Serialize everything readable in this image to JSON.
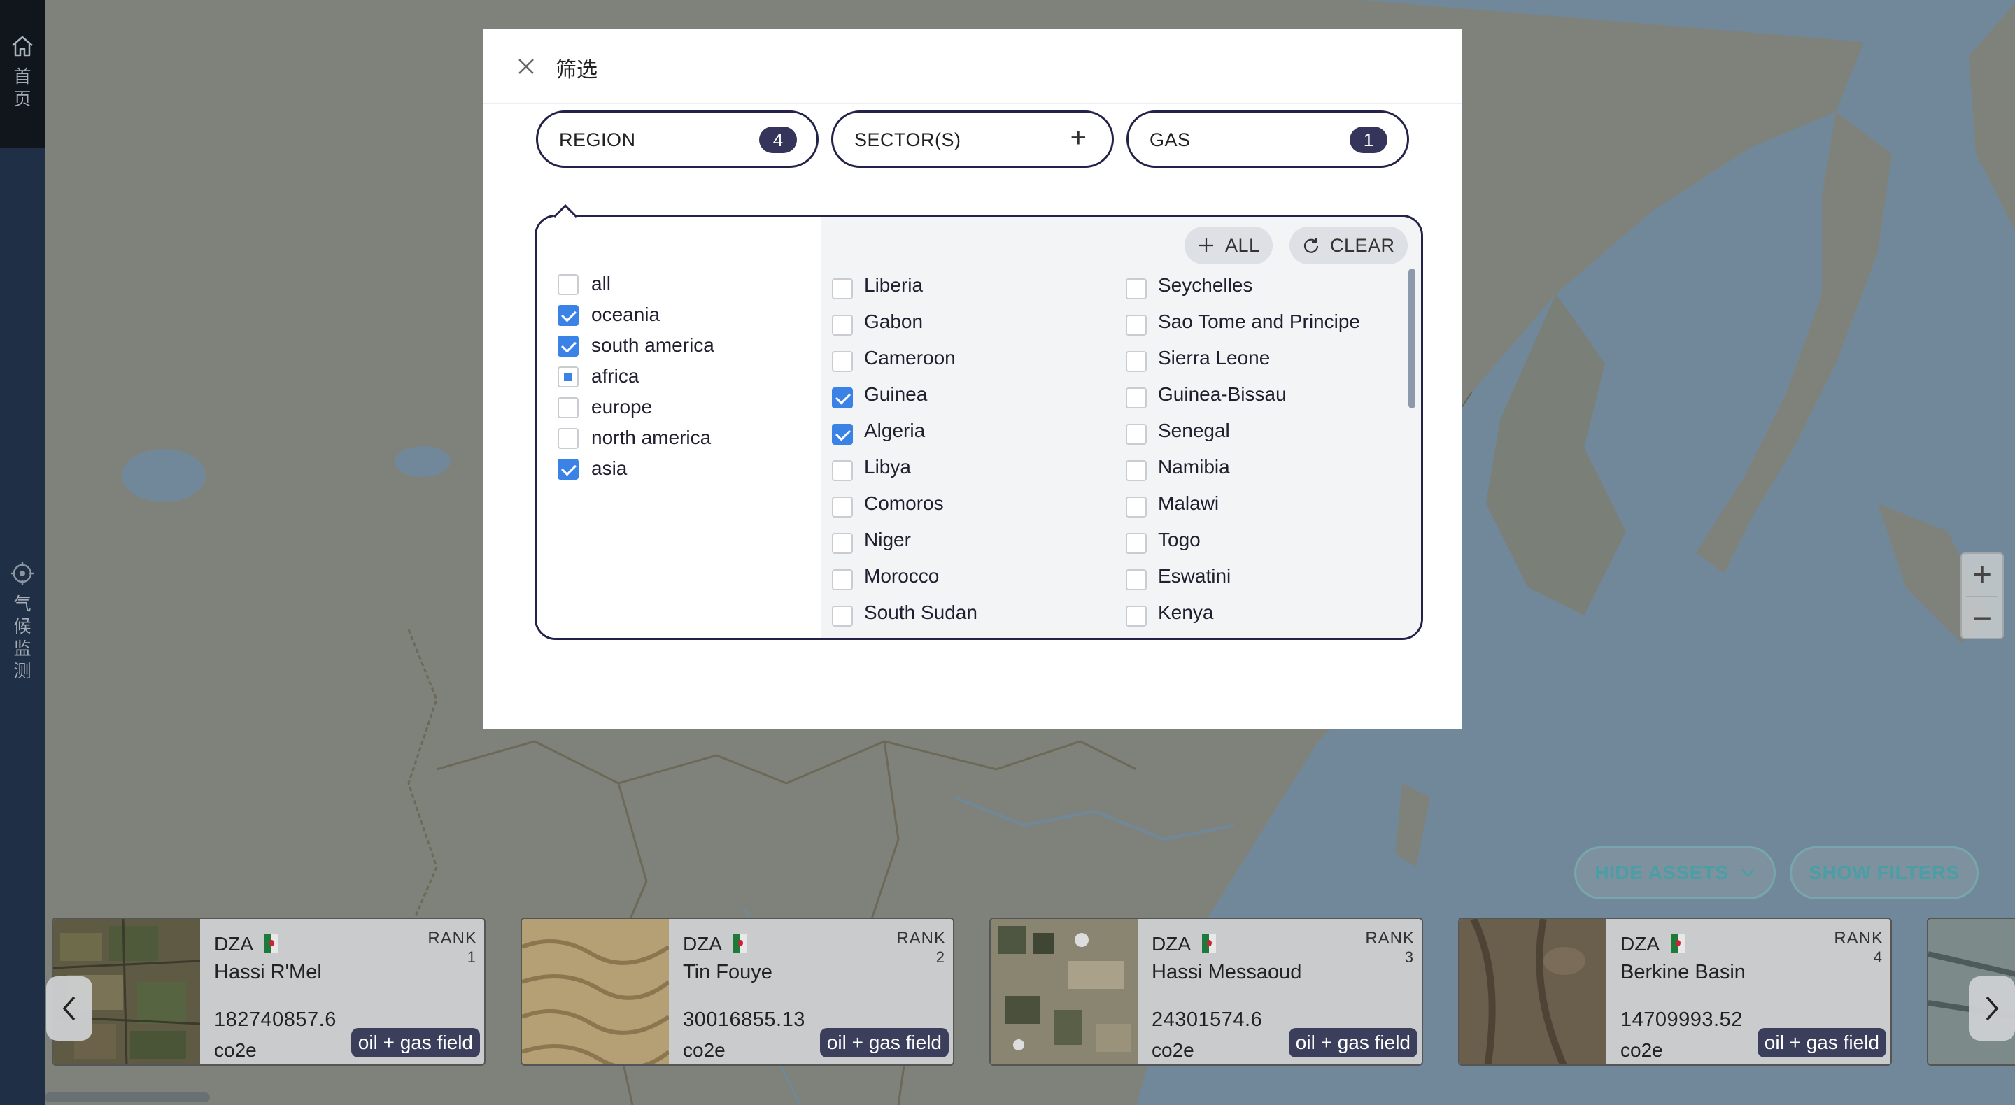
{
  "nav": {
    "home_label": "首页",
    "climate_label": "气候监测"
  },
  "modal": {
    "title": "筛选",
    "filters": [
      {
        "label": "REGION",
        "badge": "4"
      },
      {
        "label": "SECTOR(S)",
        "badge": "+"
      },
      {
        "label": "GAS",
        "badge": "1"
      }
    ],
    "chips": {
      "all_label": "ALL",
      "clear_label": "CLEAR"
    },
    "regions": [
      {
        "label": "all",
        "state": "unchecked"
      },
      {
        "label": "oceania",
        "state": "checked"
      },
      {
        "label": "south america",
        "state": "checked"
      },
      {
        "label": "africa",
        "state": "partial"
      },
      {
        "label": "europe",
        "state": "unchecked"
      },
      {
        "label": "north america",
        "state": "unchecked"
      },
      {
        "label": "asia",
        "state": "checked"
      }
    ],
    "countries_col1": [
      {
        "label": "Liberia",
        "checked": false
      },
      {
        "label": "Gabon",
        "checked": false
      },
      {
        "label": "Cameroon",
        "checked": false
      },
      {
        "label": "Guinea",
        "checked": true
      },
      {
        "label": "Algeria",
        "checked": true
      },
      {
        "label": "Libya",
        "checked": false
      },
      {
        "label": "Comoros",
        "checked": false
      },
      {
        "label": "Niger",
        "checked": false
      },
      {
        "label": "Morocco",
        "checked": false
      },
      {
        "label": "South Sudan",
        "checked": false
      }
    ],
    "countries_col2": [
      {
        "label": "Seychelles",
        "checked": false
      },
      {
        "label": "Sao Tome and Principe",
        "checked": false
      },
      {
        "label": "Sierra Leone",
        "checked": false
      },
      {
        "label": "Guinea-Bissau",
        "checked": false
      },
      {
        "label": "Senegal",
        "checked": false
      },
      {
        "label": "Namibia",
        "checked": false
      },
      {
        "label": "Malawi",
        "checked": false
      },
      {
        "label": "Togo",
        "checked": false
      },
      {
        "label": "Eswatini",
        "checked": false
      },
      {
        "label": "Kenya",
        "checked": false
      }
    ]
  },
  "controls": {
    "hide_assets_label": "HIDE ASSETS",
    "show_filters_label": "SHOW FILTERS",
    "zoom_in": "+",
    "zoom_out": "−"
  },
  "assets": [
    {
      "iso": "DZA",
      "rank_label": "RANK",
      "rank": "1",
      "name": "Hassi R'Mel",
      "value": "182740857.6",
      "unit": "co2e",
      "type": "oil + gas field"
    },
    {
      "iso": "DZA",
      "rank_label": "RANK",
      "rank": "2",
      "name": "Tin Fouye",
      "value": "30016855.13",
      "unit": "co2e",
      "type": "oil + gas field"
    },
    {
      "iso": "DZA",
      "rank_label": "RANK",
      "rank": "3",
      "name": "Hassi Messaoud",
      "value": "24301574.6",
      "unit": "co2e",
      "type": "oil + gas field"
    },
    {
      "iso": "DZA",
      "rank_label": "RANK",
      "rank": "4",
      "name": "Berkine Basin",
      "value": "14709993.52",
      "unit": "co2e",
      "type": "oil + gas field"
    }
  ],
  "colors": {
    "accent": "#3b82e6",
    "dark_outline": "#23234a",
    "badge": "#35355c",
    "teal_button": "#4b9ea5",
    "nav_bg": "#1f2f45"
  }
}
